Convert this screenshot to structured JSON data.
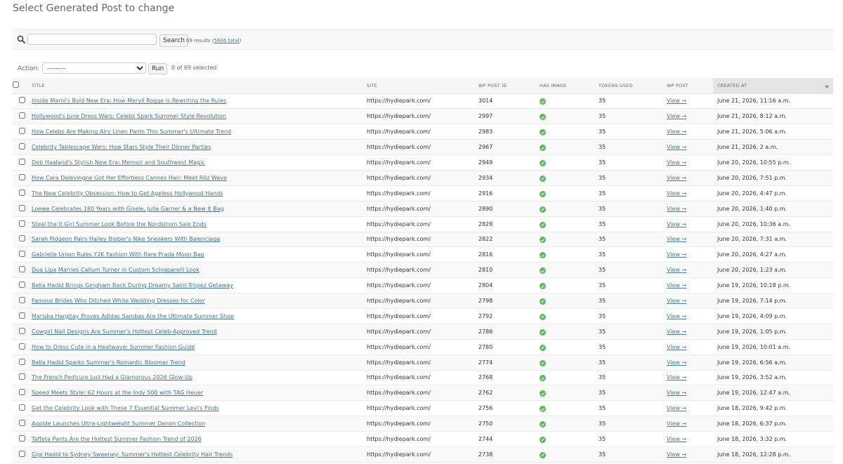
{
  "page": {
    "title": "Select Generated Post to change"
  },
  "search": {
    "placeholder": "",
    "value": "",
    "button_label": "Search",
    "results_text": "69 results (",
    "total_text": "5606 total",
    "results_close": ")"
  },
  "actions": {
    "label": "Action:",
    "selected_option": "---------",
    "run_label": "Run",
    "selected_text": "0 of 69 selected"
  },
  "table": {
    "columns": {
      "title": "TITLE",
      "site": "SITE",
      "wp_post_id": "WP POST ID",
      "has_image": "HAS IMAGE",
      "tokens_used": "TOKENS USED",
      "wp_post": "WP POST",
      "created_at": "CREATED AT"
    },
    "rows": [
      {
        "title": "Inside Marni's Bold New Era: How Meryll Rogge is Rewriting the Rules",
        "site": "https://hydiepark.com/",
        "id": "3014",
        "tokens": "35",
        "view": "View →",
        "created": "June 21, 2026, 11:16 a.m."
      },
      {
        "title": "Hollywood's June Dress Wars: Celebs Spark Summer Style Revolution",
        "site": "https://hydiepark.com/",
        "id": "2997",
        "tokens": "35",
        "view": "View →",
        "created": "June 21, 2026, 8:12 a.m."
      },
      {
        "title": "How Celebs Are Making Airy Linen Pants This Summer's Ultimate Trend",
        "site": "https://hydiepark.com/",
        "id": "2983",
        "tokens": "35",
        "view": "View →",
        "created": "June 21, 2026, 5:06 a.m."
      },
      {
        "title": "Celebrity Tablescape Wars: How Stars Style Their Dinner Parties",
        "site": "https://hydiepark.com/",
        "id": "2967",
        "tokens": "35",
        "view": "View →",
        "created": "June 21, 2026, 2 a.m."
      },
      {
        "title": "Deb Haaland's Stylish New Era: Memoir and Southwest Magic",
        "site": "https://hydiepark.com/",
        "id": "2949",
        "tokens": "35",
        "view": "View →",
        "created": "June 20, 2026, 10:55 p.m."
      },
      {
        "title": "How Cara Delevingne Got Her Effortless Cannes Hair: Meet Rōz Wave",
        "site": "https://hydiepark.com/",
        "id": "2934",
        "tokens": "35",
        "view": "View →",
        "created": "June 20, 2026, 7:51 p.m."
      },
      {
        "title": "The New Celebrity Obsession: How to Get Ageless Hollywood Hands",
        "site": "https://hydiepark.com/",
        "id": "2916",
        "tokens": "35",
        "view": "View →",
        "created": "June 20, 2026, 4:47 p.m."
      },
      {
        "title": "Loewe Celebrates 180 Years with Gisele, Julia Garner & a New It Bag",
        "site": "https://hydiepark.com/",
        "id": "2890",
        "tokens": "35",
        "view": "View →",
        "created": "June 20, 2026, 1:40 p.m."
      },
      {
        "title": "Steal the It Girl Summer Look Before the Nordstrom Sale Ends",
        "site": "https://hydiepark.com/",
        "id": "2828",
        "tokens": "35",
        "view": "View →",
        "created": "June 20, 2026, 10:36 a.m."
      },
      {
        "title": "Sarah Pidgeon Pairs Hailey Bieber's Nike Sneakers With Balenciaga",
        "site": "https://hydiepark.com/",
        "id": "2822",
        "tokens": "35",
        "view": "View →",
        "created": "June 20, 2026, 7:31 a.m."
      },
      {
        "title": "Gabrielle Union Rules Y2K Fashion With Rare Prada Moon Bag",
        "site": "https://hydiepark.com/",
        "id": "2816",
        "tokens": "35",
        "view": "View →",
        "created": "June 20, 2026, 4:27 a.m."
      },
      {
        "title": "Dua Lipa Marries Callum Turner in Custom Schiaparelli Look",
        "site": "https://hydiepark.com/",
        "id": "2810",
        "tokens": "35",
        "view": "View →",
        "created": "June 20, 2026, 1:23 a.m."
      },
      {
        "title": "Bella Hadid Brings Gingham Back During Dreamy Saint-Tropez Getaway",
        "site": "https://hydiepark.com/",
        "id": "2804",
        "tokens": "35",
        "view": "View →",
        "created": "June 19, 2026, 10:18 p.m."
      },
      {
        "title": "Famous Brides Who Ditched White Wedding Dresses for Color",
        "site": "https://hydiepark.com/",
        "id": "2798",
        "tokens": "35",
        "view": "View →",
        "created": "June 19, 2026, 7:14 p.m."
      },
      {
        "title": "Mariska Hargitay Proves Adidas Sambas Are the Ultimate Summer Shoe",
        "site": "https://hydiepark.com/",
        "id": "2792",
        "tokens": "35",
        "view": "View →",
        "created": "June 19, 2026, 4:09 p.m."
      },
      {
        "title": "Cowgirl Nail Designs Are Summer's Hottest Celeb-Approved Trend",
        "site": "https://hydiepark.com/",
        "id": "2786",
        "tokens": "35",
        "view": "View →",
        "created": "June 19, 2026, 1:05 p.m."
      },
      {
        "title": "How to Dress Cute in a Heatwave: Summer Fashion Guide",
        "site": "https://hydiepark.com/",
        "id": "2780",
        "tokens": "35",
        "view": "View →",
        "created": "June 19, 2026, 10:01 a.m."
      },
      {
        "title": "Bella Hadid Sparks Summer's Romantic Bloomer Trend",
        "site": "https://hydiepark.com/",
        "id": "2774",
        "tokens": "35",
        "view": "View →",
        "created": "June 19, 2026, 6:56 a.m."
      },
      {
        "title": "The French Pedicure Just Had a Glamorous 2026 Glow-Up",
        "site": "https://hydiepark.com/",
        "id": "2768",
        "tokens": "35",
        "view": "View →",
        "created": "June 19, 2026, 3:52 a.m."
      },
      {
        "title": "Speed Meets Style: 62 Hours at the Indy 500 with TAG Heuer",
        "site": "https://hydiepark.com/",
        "id": "2762",
        "tokens": "35",
        "view": "View →",
        "created": "June 19, 2026, 12:47 a.m."
      },
      {
        "title": "Get the Celebrity Look with These 7 Essential Summer Levi's Finds",
        "site": "https://hydiepark.com/",
        "id": "2756",
        "tokens": "35",
        "view": "View →",
        "created": "June 18, 2026, 9:42 p.m."
      },
      {
        "title": "Agolde Launches Ultra-Lightweight Summer Denim Collection",
        "site": "https://hydiepark.com/",
        "id": "2750",
        "tokens": "35",
        "view": "View →",
        "created": "June 18, 2026, 6:37 p.m."
      },
      {
        "title": "Taffeta Pants Are the Hottest Summer Fashion Trend of 2026",
        "site": "https://hydiepark.com/",
        "id": "2744",
        "tokens": "35",
        "view": "View →",
        "created": "June 18, 2026, 3:32 p.m."
      },
      {
        "title": "Gigi Hadid to Sydney Sweeney: Summer's Hottest Celebrity Hair Trends",
        "site": "https://hydiepark.com/",
        "id": "2738",
        "tokens": "35",
        "view": "View →",
        "created": "June 18, 2026, 12:28 p.m."
      }
    ]
  },
  "colors": {
    "link": "#417690",
    "has_image_yes": "#5cb85c",
    "header_bg": "#f6f6f6",
    "sorted_header_bg": "#e5e5e5"
  },
  "icons": {
    "search": "search-icon",
    "has_image": "check-circle-icon",
    "sort": "sort-descending-icon"
  }
}
